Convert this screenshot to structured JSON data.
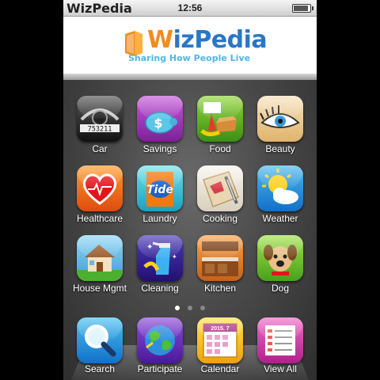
{
  "status_bar": {
    "carrier": "WizPedia",
    "time": "12:56",
    "battery_level": 0.9
  },
  "header": {
    "logo_title_initial": "W",
    "logo_title_rest": "izPedia",
    "tagline": "Sharing How People Live"
  },
  "colors": {
    "logo_orange": "#f28c1e",
    "logo_blue": "#2a77c6",
    "tagline": "#4db8e6"
  },
  "apps": [
    {
      "label": "Car",
      "icon": "car-dashboard-icon"
    },
    {
      "label": "Savings",
      "icon": "piggy-bank-icon"
    },
    {
      "label": "Food",
      "icon": "food-icon"
    },
    {
      "label": "Beauty",
      "icon": "eye-makeup-icon"
    },
    {
      "label": "Healthcare",
      "icon": "heart-icon"
    },
    {
      "label": "Laundry",
      "icon": "detergent-box-icon"
    },
    {
      "label": "Cooking",
      "icon": "cutting-board-icon"
    },
    {
      "label": "Weather",
      "icon": "sun-cloud-icon"
    },
    {
      "label": "House Mgmt",
      "icon": "house-icon"
    },
    {
      "label": "Cleaning",
      "icon": "spray-bottle-icon"
    },
    {
      "label": "Kitchen",
      "icon": "kitchen-icon"
    },
    {
      "label": "Dog",
      "icon": "dog-icon"
    }
  ],
  "page_indicator": {
    "pages": 3,
    "active": 1
  },
  "dock": [
    {
      "label": "Search",
      "icon": "magnifier-icon"
    },
    {
      "label": "Participate",
      "icon": "globe-icon"
    },
    {
      "label": "Calendar",
      "icon": "calendar-icon",
      "date_text": "2015. 7"
    },
    {
      "label": "View All",
      "icon": "list-icon"
    }
  ]
}
